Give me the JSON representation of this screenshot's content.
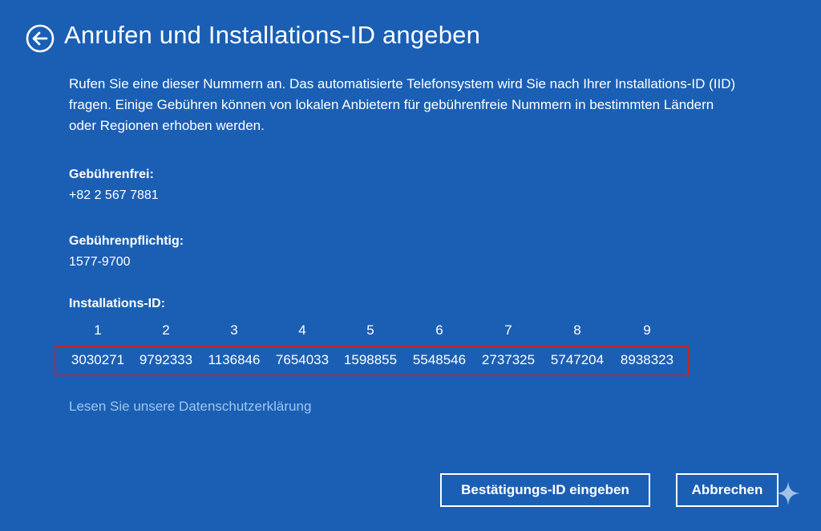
{
  "header": {
    "title": "Anrufen und Installations-ID angeben",
    "back_icon": "back-arrow-circle-icon"
  },
  "intro": "Rufen Sie eine dieser Nummern an. Das automatisierte Telefonsystem wird Sie nach Ihrer Installations-ID (IID) fragen. Einige Gebühren können von lokalen Anbietern für gebührenfreie Nummern in bestimmten Ländern oder Regionen erhoben werden.",
  "toll_free": {
    "label": "Gebührenfrei:",
    "number": "+82 2 567 7881"
  },
  "toll": {
    "label": "Gebührenpflichtig:",
    "number": "1577-9700"
  },
  "installation_id": {
    "label": "Installations-ID:",
    "columns": [
      "1",
      "2",
      "3",
      "4",
      "5",
      "6",
      "7",
      "8",
      "9"
    ],
    "groups": [
      "3030271",
      "9792333",
      "1136846",
      "7654033",
      "1598855",
      "5548546",
      "2737325",
      "5747204",
      "8938323"
    ],
    "highlight_color": "#c0262e"
  },
  "privacy_link": "Lesen Sie unsere Datenschutzerklärung",
  "buttons": {
    "confirm": "Bestätigungs-ID eingeben",
    "cancel": "Abbrechen"
  },
  "colors": {
    "background": "#1b5fb4",
    "link": "#9cc7f0",
    "text": "#ffffff"
  }
}
